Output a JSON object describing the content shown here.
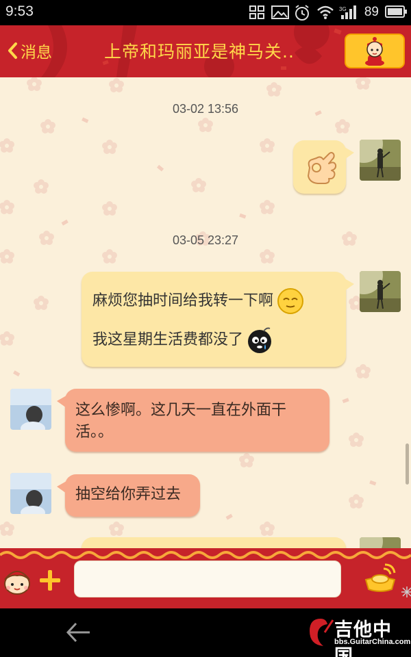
{
  "status_bar": {
    "time": "9:53",
    "battery": "89",
    "signal_label": "3G"
  },
  "header": {
    "back_label": "消息",
    "title": "上帝和玛丽亚是神马关.."
  },
  "chat": {
    "timestamp_1": "03-02 13:56",
    "timestamp_2": "03-05 23:27",
    "msg_2_line_1": "麻烦您抽时间给我转一下啊",
    "msg_2_line_2": "我这星期生活费都没了",
    "msg_3_line_1": "这么惨啊。这几天一直在外面干",
    "msg_3_line_2": "活。。",
    "msg_4": "抽空给你弄过去"
  },
  "input": {
    "placeholder": ""
  },
  "watermark": {
    "text": "吉他中国",
    "url": "bbs.GuitarChina.com"
  },
  "colors": {
    "theme_red": "#c6232a",
    "title_yellow": "#ffd84a",
    "chat_bg": "#fbf0da",
    "my_bubble": "#fde7a6",
    "their_bubble": "#f7a98a"
  }
}
